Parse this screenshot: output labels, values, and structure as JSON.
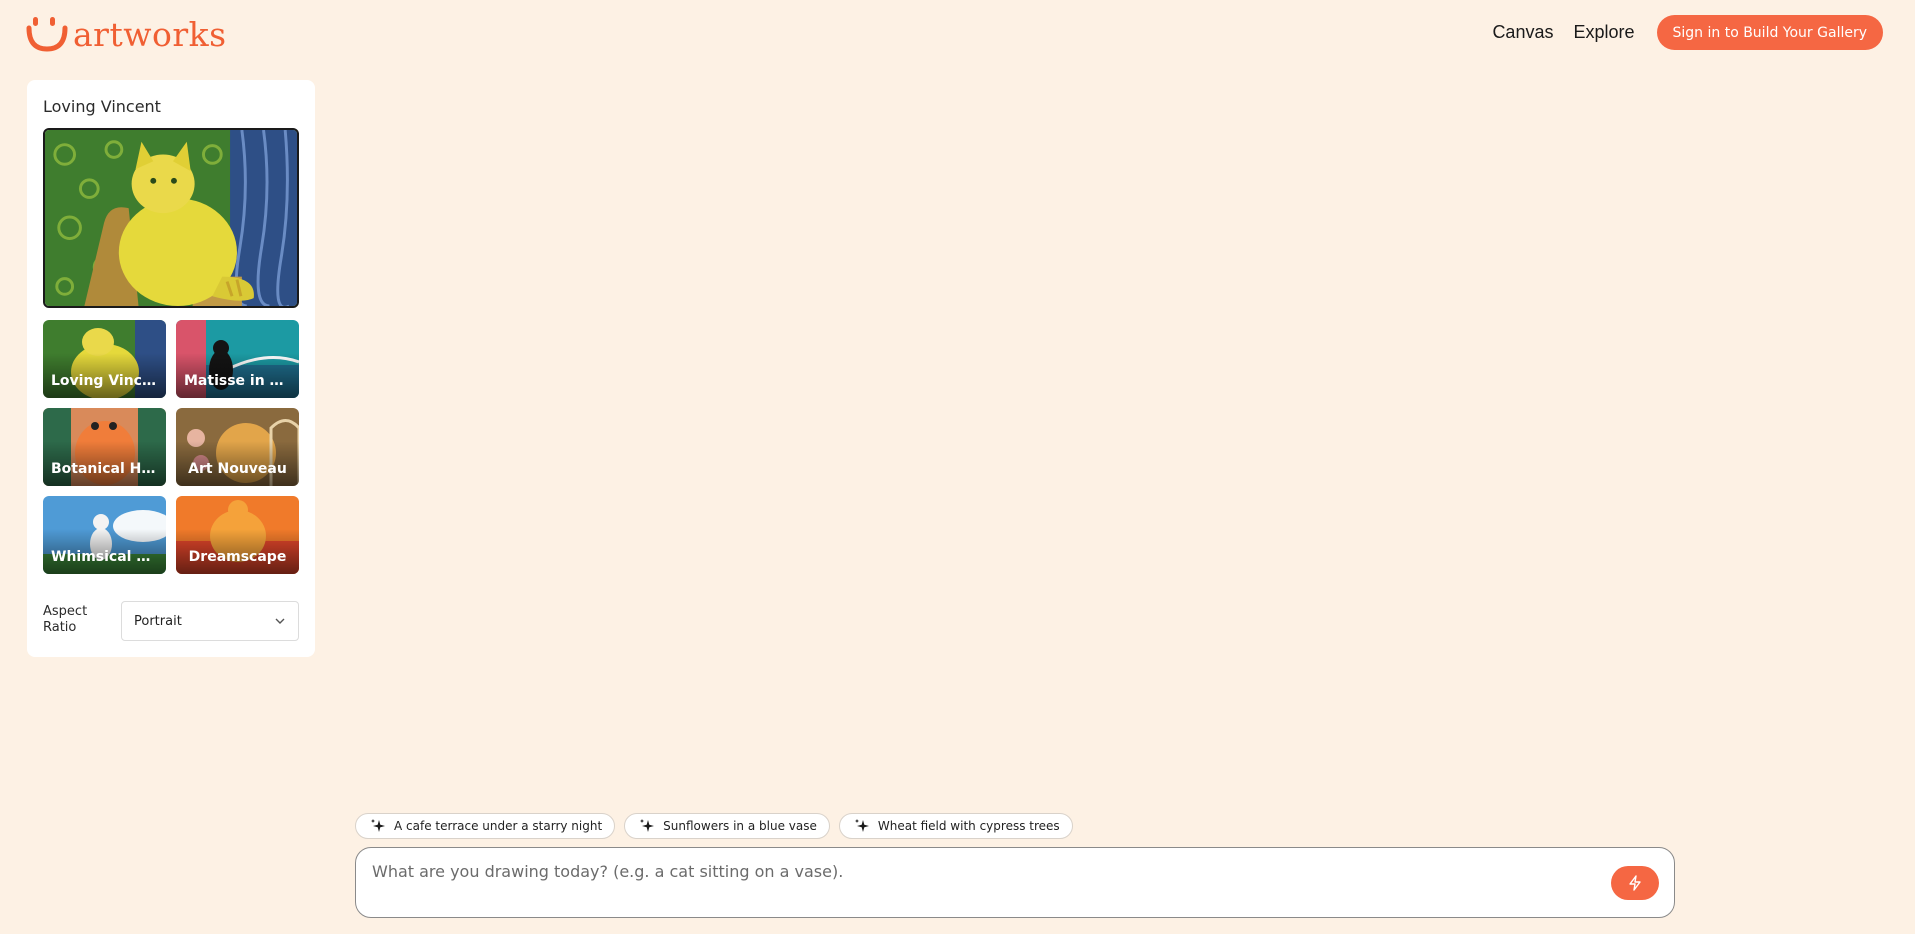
{
  "brand": {
    "name": "artworks",
    "color": "#f05f33"
  },
  "nav": {
    "links": [
      "Canvas",
      "Explore"
    ],
    "cta": "Sign in to Build Your Gallery",
    "cta_color": "#f56743"
  },
  "panel": {
    "title": "Loving Vincent",
    "styles": [
      {
        "label": "Loving Vincent",
        "display": "Loving Vince..."
      },
      {
        "label": "Matisse in Nice",
        "display": "Matisse in Ni..."
      },
      {
        "label": "Botanical Haven",
        "display": "Botanical Ha..."
      },
      {
        "label": "Art Nouveau",
        "display": "Art Nouveau"
      },
      {
        "label": "Whimsical Anime",
        "display": "Whimsical A..."
      },
      {
        "label": "Dreamscape",
        "display": "Dreamscape"
      }
    ],
    "aspect_ratio": {
      "label": "Aspect Ratio",
      "value": "Portrait"
    }
  },
  "suggestions": [
    "A cafe terrace under a starry night",
    "Sunflowers in a blue vase",
    "Wheat field with cypress trees"
  ],
  "prompt": {
    "placeholder": "What are you drawing today? (e.g. a cat sitting on a vase).",
    "value": ""
  }
}
